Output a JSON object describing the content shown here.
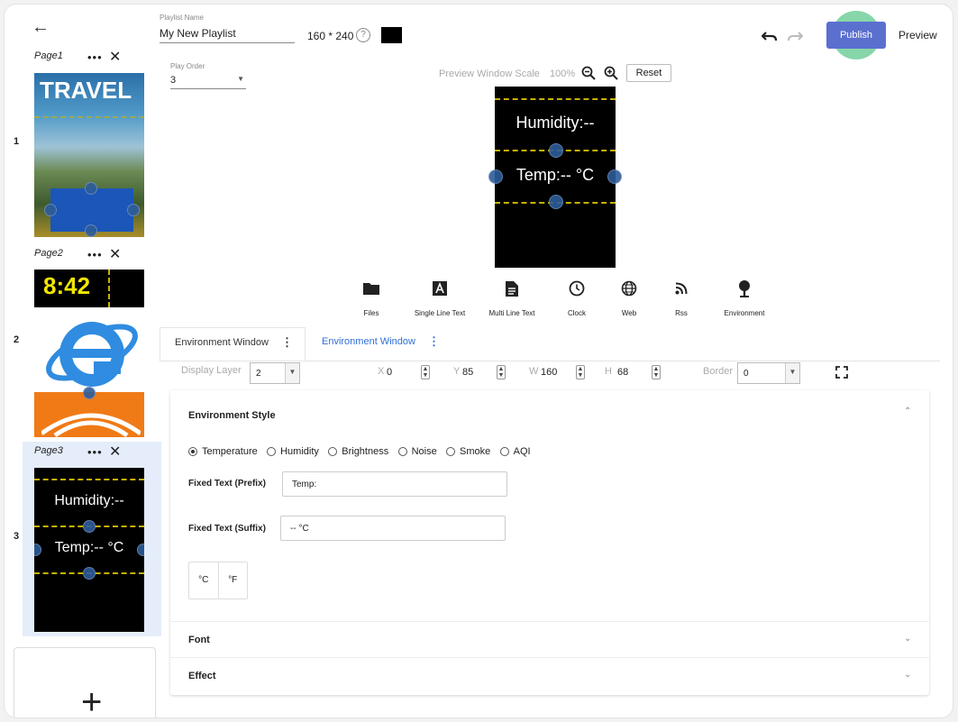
{
  "sidebar": {
    "pages": [
      {
        "number": "1",
        "title": "Page1",
        "thumb_text": "TRAVEL"
      },
      {
        "number": "2",
        "title": "Page2",
        "thumb_text": "8:42"
      },
      {
        "number": "3",
        "title": "Page3",
        "thumb_text_1": "Humidity:--",
        "thumb_text_2": "Temp:-- °C"
      }
    ],
    "actions_glyph": "•••",
    "close_glyph": "✕",
    "add_glyph": "+"
  },
  "header": {
    "playlist_name_label": "Playlist Name",
    "playlist_name": "My New Playlist",
    "resolution": "160 * 240",
    "play_order_label": "Play Order",
    "play_order_value": "3",
    "preview_scale_label": "Preview Window Scale",
    "preview_scale_value": "100%",
    "reset": "Reset",
    "publish": "Publish",
    "preview": "Preview"
  },
  "preview_window": {
    "line1": "Humidity:--",
    "line2": "Temp:-- °C"
  },
  "toolbar": [
    {
      "label": "Files",
      "icon": "folder-icon"
    },
    {
      "label": "Single Line Text",
      "icon": "single-line-text-icon"
    },
    {
      "label": "Multi Line Text",
      "icon": "multi-line-text-icon"
    },
    {
      "label": "Clock",
      "icon": "clock-icon"
    },
    {
      "label": "Web",
      "icon": "globe-icon"
    },
    {
      "label": "Rss",
      "icon": "rss-icon"
    },
    {
      "label": "Environment",
      "icon": "environment-icon"
    }
  ],
  "tabs": [
    {
      "label": "Environment Window"
    },
    {
      "label": "Environment Window"
    }
  ],
  "properties": {
    "display_layer_label": "Display Layer",
    "display_layer_value": "2",
    "x_label": "X",
    "x_value": "0",
    "y_label": "Y",
    "y_value": "85",
    "w_label": "W",
    "w_value": "160",
    "h_label": "H",
    "h_value": "68",
    "border_label": "Border",
    "border_value": "0"
  },
  "environment_style": {
    "title": "Environment Style",
    "options": [
      "Temperature",
      "Humidity",
      "Brightness",
      "Noise",
      "Smoke",
      "AQI"
    ],
    "selected_index": 0,
    "prefix_label": "Fixed Text (Prefix)",
    "prefix_value": "Temp:",
    "suffix_label": "Fixed Text (Suffix)",
    "suffix_value": "-- °C",
    "unit_c": "°C",
    "unit_f": "°F"
  },
  "sections": {
    "font": "Font",
    "effect": "Effect"
  },
  "colors": {
    "accent": "#5b6fcf",
    "link": "#2f6fd6",
    "handle": "#2d5d9a",
    "dash": "#c8b100"
  }
}
